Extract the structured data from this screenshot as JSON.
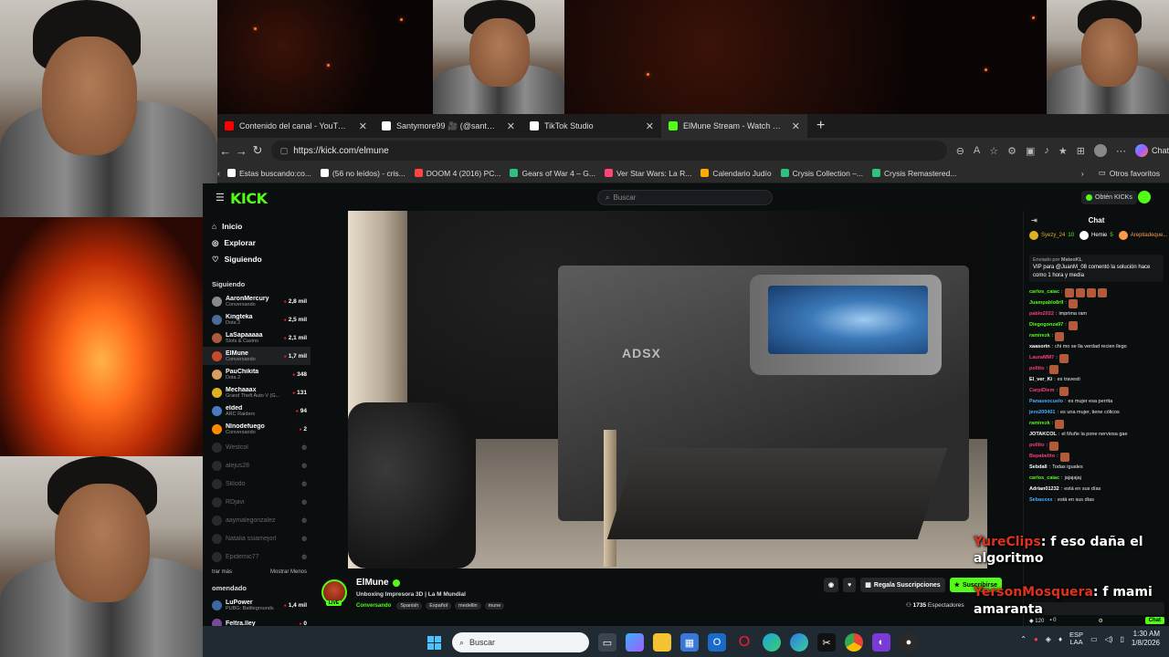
{
  "browser": {
    "tabs": [
      {
        "title": "Contenido del canal - YouTube Studio",
        "icon": "youtube-icon",
        "color": "#ff0000"
      },
      {
        "title": "Santymore99 🎥 (@santymore",
        "icon": "tiktok-icon",
        "color": "#ffffff"
      },
      {
        "title": "TikTok Studio",
        "icon": "tiktok-icon",
        "color": "#ffffff"
      },
      {
        "title": "ElMune Stream - Watch Live o",
        "icon": "kick-icon",
        "color": "#53fc18"
      }
    ],
    "url": "https://kick.com/elmune",
    "chat_label": "Chat",
    "bookmarks": [
      {
        "label": "Estas buscando:co...",
        "color": "#ffffff"
      },
      {
        "label": "(56 no leídos) - cris...",
        "color": "#ffffff"
      },
      {
        "label": "DOOM 4 (2016) PC...",
        "color": "#ff4444"
      },
      {
        "label": "Gears of War 4 – G...",
        "color": "#2ec27e"
      },
      {
        "label": "Ver Star Wars: La R...",
        "color": "#ff4477"
      },
      {
        "label": "Calendario Judío",
        "color": "#ffaa00"
      },
      {
        "label": "Crysis Collection –...",
        "color": "#2ec27e"
      },
      {
        "label": "Crysis Remastered...",
        "color": "#2ec27e"
      }
    ],
    "other_favorites": "Otros favoritos"
  },
  "kick": {
    "logo": "KICK",
    "search_placeholder": "Buscar",
    "get_kicks": "Obtén KICKs",
    "nav": [
      {
        "label": "Inicio",
        "icon": "home-icon"
      },
      {
        "label": "Explorar",
        "icon": "compass-icon"
      },
      {
        "label": "Siguiendo",
        "icon": "heart-icon"
      }
    ],
    "following_heading": "Siguiendo",
    "following": [
      {
        "name": "AaronMercury",
        "category": "Conversando",
        "count": "2,8 mil",
        "color": "#8a8a8a",
        "online": true
      },
      {
        "name": "Kingteka",
        "category": "Dota 2",
        "count": "2,5 mil",
        "color": "#4a6a9a",
        "online": true
      },
      {
        "name": "LaSapaaaaa",
        "category": "Slots & Casino",
        "count": "2,1 mil",
        "color": "#aa5a3a",
        "online": true
      },
      {
        "name": "ElMune",
        "category": "Conversando",
        "count": "1,7 mil",
        "color": "#c84a2a",
        "online": true
      },
      {
        "name": "PauChikita",
        "category": "Dota 2",
        "count": "348",
        "color": "#d8a060",
        "online": true
      },
      {
        "name": "Mechaaax",
        "category": "Grand Theft Auto V (G...",
        "count": "131",
        "color": "#e0b020",
        "online": true
      },
      {
        "name": "elded",
        "category": "ARC Raiders",
        "count": "94",
        "color": "#4a7ac0",
        "online": true
      },
      {
        "name": "Nlnodefuego",
        "category": "Conversando",
        "count": "2",
        "color": "#ff8800",
        "online": true
      },
      {
        "name": "Westcol",
        "category": "",
        "count": "",
        "color": "#555555",
        "online": false
      },
      {
        "name": "alejus28",
        "category": "",
        "count": "",
        "color": "#555555",
        "online": false
      },
      {
        "name": "Sklodo",
        "category": "",
        "count": "",
        "color": "#555555",
        "online": false
      },
      {
        "name": "RDjavi",
        "category": "",
        "count": "",
        "color": "#555555",
        "online": false
      },
      {
        "name": "aaymalegonzalez",
        "category": "",
        "count": "",
        "color": "#555555",
        "online": false
      },
      {
        "name": "Natalia ssiamejorl",
        "category": "",
        "count": "",
        "color": "#555555",
        "online": false
      },
      {
        "name": "Epidemic77",
        "category": "",
        "count": "",
        "color": "#555555",
        "online": false
      }
    ],
    "show_more": "trar más",
    "show_less": "Mostrar Menos",
    "recommended_heading": "omendado",
    "recommended": [
      {
        "name": "LuPower",
        "category": "PUBG: Battlegrounds",
        "count": "1,4 mil",
        "color": "#3a6aa0",
        "online": true
      },
      {
        "name": "Feltra.lley",
        "category": "",
        "count": "0",
        "color": "#7a4a9a",
        "online": true
      }
    ],
    "stream": {
      "streamer": "ElMune",
      "live": "LIVE",
      "title": "Unboxing Impresora 3D | La M Mundial",
      "category": "Conversando",
      "tags": [
        "Spanish",
        "Español",
        "medellin",
        "mune"
      ],
      "printer_brand": "ADSX",
      "gift_subs": "Regala Suscripciones",
      "subscribe": "Suscribirse",
      "viewers": "1735",
      "viewers_label": "Espectadores"
    },
    "chat": {
      "title": "Chat",
      "pins": [
        {
          "user": "Syezy_24",
          "sub": "10",
          "color": "#e0b020"
        },
        {
          "user": "Hemie",
          "sub": "5",
          "color": "#ffffff"
        },
        {
          "user": "Arepitadeque...",
          "sub": "5",
          "color": "#ff9944"
        }
      ],
      "pinned_by": "Enviado por",
      "pinned_user": "MateoKL",
      "pinned_text": "VIP para @JuanM_08 comentó la solución hace como 1 hora y media",
      "messages": [
        {
          "user": "carlos_caiac",
          "text": "",
          "color": "#53fc18",
          "emotes": 4
        },
        {
          "user": "Juampablo8rII",
          "text": "",
          "color": "#53fc18",
          "emotes": 1
        },
        {
          "user": "pablo2022",
          "text": "imprima ram",
          "color": "#ff3b7a",
          "emotes": 0
        },
        {
          "user": "Diegogonza97",
          "text": "",
          "color": "#53fc18",
          "emotes": 1
        },
        {
          "user": "ramirezk",
          "text": "",
          "color": "#53fc18",
          "emotes": 1
        },
        {
          "user": "xaasorin",
          "text": "chi mo se lla verdad recien llego",
          "color": "#ffffff",
          "emotes": 0
        },
        {
          "user": "LauraMM7",
          "text": "",
          "color": "#ff3b7a",
          "emotes": 1
        },
        {
          "user": "pollito",
          "text": "",
          "color": "#ff3b7a",
          "emotes": 1
        },
        {
          "user": "El_ver_Ki",
          "text": "es travesti",
          "color": "#ffffff",
          "emotes": 0
        },
        {
          "user": "CarpiDiem",
          "text": "",
          "color": "#ff3b7a",
          "emotes": 1
        },
        {
          "user": "Panaseocuelo",
          "text": "es mujer esa perrita",
          "color": "#4ab0ff",
          "emotes": 0
        },
        {
          "user": "jero200401",
          "text": "es una mujer, tiene cólicos",
          "color": "#4ab0ff",
          "emotes": 0
        },
        {
          "user": "ramirezk",
          "text": "",
          "color": "#53fc18",
          "emotes": 1
        },
        {
          "user": "JOTAKCOL",
          "text": "el Muñe la pone nerviosa gae",
          "color": "#ffffff",
          "emotes": 0
        },
        {
          "user": "pollito",
          "text": "",
          "color": "#ff3b7a",
          "emotes": 1
        },
        {
          "user": "Bepabelito",
          "text": "",
          "color": "#ff3b7a",
          "emotes": 1
        },
        {
          "user": "Sebdall",
          "text": "Todas iguales",
          "color": "#ffffff",
          "emotes": 0
        },
        {
          "user": "carlos_caiac",
          "text": "jajajajaj",
          "color": "#53fc18",
          "emotes": 0
        },
        {
          "user": "Adrian01232",
          "text": "está en sus días",
          "color": "#ffffff",
          "emotes": 0
        },
        {
          "user": "Sebasxxx",
          "text": "está en sus días",
          "color": "#4ab0ff",
          "emotes": 0
        }
      ],
      "bottom_count": "120",
      "bottom_count2": "0",
      "send": "Chat"
    }
  },
  "overlay_chat": [
    {
      "user": "YureClips",
      "text": ": f eso daña el algoritmo"
    },
    {
      "user": "YersonMosquera",
      "text": ": f mami amaranta"
    }
  ],
  "taskbar": {
    "search_placeholder": "Buscar",
    "lang_top": "ESP",
    "lang_bottom": "LAA",
    "time": "1:30 AM",
    "date": "1/8/2026"
  }
}
